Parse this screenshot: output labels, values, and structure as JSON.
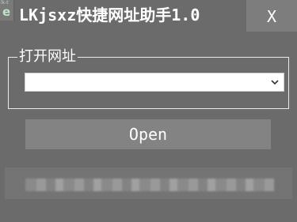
{
  "window": {
    "icon_text": "e",
    "icon_small_text": "lk-t",
    "title": "LKjsxz快捷网址助手1.0",
    "close_label": "X"
  },
  "url_group": {
    "legend": "打开网址",
    "selected_value": ""
  },
  "actions": {
    "open_label": "Open"
  },
  "status": {
    "text": ""
  },
  "colors": {
    "background": "#6b6b6b",
    "close_button": "#7d7d7d",
    "open_button": "#838383",
    "border": "#e9e9e9"
  }
}
